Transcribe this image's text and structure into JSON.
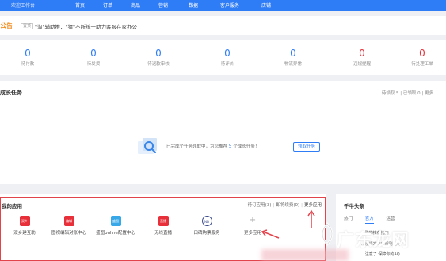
{
  "topbar": {
    "brand": "欢迎工作台",
    "nav": [
      "首页",
      "订单",
      "商品",
      "营销",
      "数据",
      "客户服务",
      "店铺"
    ]
  },
  "notice": {
    "title": "公告",
    "tag": "置顶",
    "text": "\"淘\"辅助推，\"猜\"不断统一助力客服在家办公"
  },
  "stats": [
    {
      "num": "0",
      "label": "待付款",
      "color": "blue"
    },
    {
      "num": "0",
      "label": "待发货",
      "color": "blue"
    },
    {
      "num": "0",
      "label": "待退款审核",
      "color": "blue"
    },
    {
      "num": "0",
      "label": "待评价",
      "color": "blue"
    },
    {
      "num": "0",
      "label": "物流异常",
      "color": "blue"
    },
    {
      "num": "0",
      "label": "违规提醒",
      "color": "red"
    },
    {
      "num": "0",
      "label": "待处理工单",
      "color": "red"
    }
  ],
  "tasks": {
    "title": "成长任务",
    "meta": "待领取 5 | 已领取 0 | 更多",
    "empty_prefix": "已完成个任务领取中，为您推荐",
    "empty_count": "5",
    "empty_suffix": "个成长任务！",
    "assign_button": "领取任务"
  },
  "apps": {
    "title": "我的应用",
    "link_1": "待订应用(3)",
    "link_2": "即将续费(0)",
    "link_3": "更多应用",
    "items": [
      {
        "label": "双乡建互助",
        "icon_text": "双乡",
        "color": "#e8303a"
      },
      {
        "label": "图视编辑对账中心",
        "icon_text": "编辑",
        "color": "#e8303a"
      },
      {
        "label": "盛图online配置中心",
        "icon_text": "盛图",
        "color": "#38a8e8"
      },
      {
        "label": "无线直播",
        "icon_text": "直播",
        "color": "#e8303a"
      },
      {
        "label": "口碑购票服务",
        "icon_text": "ND",
        "color": "circle"
      },
      {
        "label": "更多应用",
        "icon_text": "+",
        "color": "plus"
      }
    ]
  },
  "news": {
    "title": "千牛头条",
    "tabs": [
      "热门",
      "官方",
      "运营"
    ],
    "items": [
      "...购物推荐指南",
      "...疫情发布新规则说明",
      "...注意了 保障你的AQ"
    ]
  },
  "watermark": "广东龙网",
  "colors": {
    "primary": "#2f7df6",
    "danger": "#e8303a",
    "notice": "#f28c1e",
    "highlight_frame": "#e2444c"
  }
}
